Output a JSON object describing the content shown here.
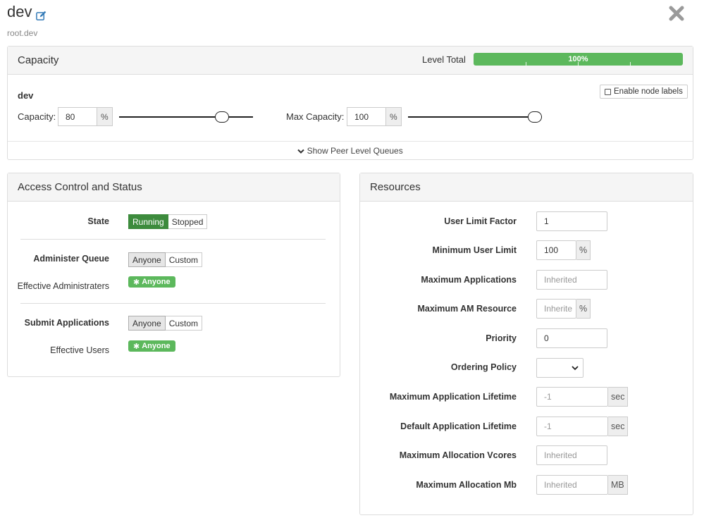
{
  "header": {
    "queue_name": "dev",
    "queue_path": "root.dev",
    "edit_icon": "edit-icon",
    "close_icon": "close-icon"
  },
  "capacity": {
    "title": "Capacity",
    "level_total_label": "Level Total",
    "level_total_value": "100%",
    "queue_name": "dev",
    "enable_node_labels": "Enable node labels",
    "capacity_label": "Capacity:",
    "capacity_value": "80",
    "capacity_unit": "%",
    "capacity_slider_value": 80,
    "max_capacity_label": "Max Capacity:",
    "max_capacity_value": "100",
    "max_capacity_unit": "%",
    "max_capacity_slider_value": 100,
    "show_peer": "Show Peer Level Queues"
  },
  "access": {
    "title": "Access Control and Status",
    "state_label": "State",
    "state_options": [
      "Running",
      "Stopped"
    ],
    "state_selected": "Running",
    "administer_label": "Administer Queue",
    "administer_options": [
      "Anyone",
      "Custom"
    ],
    "effective_admins_label": "Effective Administraters",
    "effective_admins_badge": "Anyone",
    "submit_label": "Submit Applications",
    "submit_options": [
      "Anyone",
      "Custom"
    ],
    "effective_users_label": "Effective Users",
    "effective_users_badge": "Anyone"
  },
  "resources": {
    "title": "Resources",
    "rows": [
      {
        "label": "User Limit Factor",
        "value": "1",
        "placeholder": "",
        "addon": ""
      },
      {
        "label": "Minimum User Limit",
        "value": "100",
        "placeholder": "",
        "addon": "%"
      },
      {
        "label": "Maximum Applications",
        "value": "",
        "placeholder": "Inherited",
        "addon": ""
      },
      {
        "label": "Maximum AM Resource",
        "value": "",
        "placeholder": "Inherite",
        "addon": "%"
      },
      {
        "label": "Priority",
        "value": "0",
        "placeholder": "",
        "addon": ""
      },
      {
        "label": "Ordering Policy",
        "value": "",
        "placeholder": "",
        "addon": ""
      },
      {
        "label": "Maximum Application Lifetime",
        "value": "",
        "placeholder": "-1",
        "addon": "sec"
      },
      {
        "label": "Default Application Lifetime",
        "value": "",
        "placeholder": "-1",
        "addon": "sec"
      },
      {
        "label": "Maximum Allocation Vcores",
        "value": "",
        "placeholder": "Inherited",
        "addon": ""
      },
      {
        "label": "Maximum Allocation Mb",
        "value": "",
        "placeholder": "Inherited",
        "addon": "MB"
      }
    ]
  },
  "colors": {
    "success": "#5cb85c",
    "success_dark": "#3d8b3d",
    "link_blue": "#337ab7"
  }
}
